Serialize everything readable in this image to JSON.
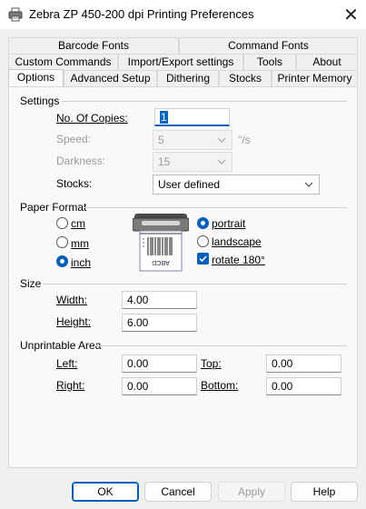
{
  "window": {
    "title": "Zebra  ZP 450-200 dpi Printing Preferences",
    "close_glyph": "✕"
  },
  "tabs": {
    "row1": [
      "Barcode Fonts",
      "Command Fonts"
    ],
    "row2": [
      "Custom Commands",
      "Import/Export settings",
      "Tools",
      "About"
    ],
    "row3": [
      "Options",
      "Advanced Setup",
      "Dithering",
      "Stocks",
      "Printer Memory"
    ],
    "active": "Options"
  },
  "settings": {
    "heading": "Settings",
    "copies_label": "No. Of Copies:",
    "copies_value": "1",
    "speed_label": "Speed:",
    "speed_value": "5",
    "speed_unit": "\"/s",
    "darkness_label": "Darkness:",
    "darkness_value": "15",
    "stocks_label": "Stocks:",
    "stocks_value": "User defined"
  },
  "paper_format": {
    "heading": "Paper Format",
    "units": [
      "cm",
      "mm",
      "inch"
    ],
    "selected_unit": "inch",
    "orientation": [
      "portrait",
      "landscape"
    ],
    "selected_orientation": "portrait",
    "rotate_label": "rotate 180°",
    "rotate_checked": true,
    "label_preview_text": "ABCD"
  },
  "size": {
    "heading": "Size",
    "width_label": "Width:",
    "width_value": "4.00",
    "height_label": "Height:",
    "height_value": "6.00"
  },
  "unprintable": {
    "heading": "Unprintable Area",
    "left_label": "Left:",
    "left_value": "0.00",
    "top_label": "Top:",
    "top_value": "0.00",
    "right_label": "Right:",
    "right_value": "0.00",
    "bottom_label": "Bottom:",
    "bottom_value": "0.00"
  },
  "buttons": {
    "ok": "OK",
    "cancel": "Cancel",
    "apply": "Apply",
    "help": "Help"
  },
  "colors": {
    "accent": "#005fb8",
    "window_bg": "#f0f0f0",
    "titlebar_bg": "#ffffff"
  }
}
